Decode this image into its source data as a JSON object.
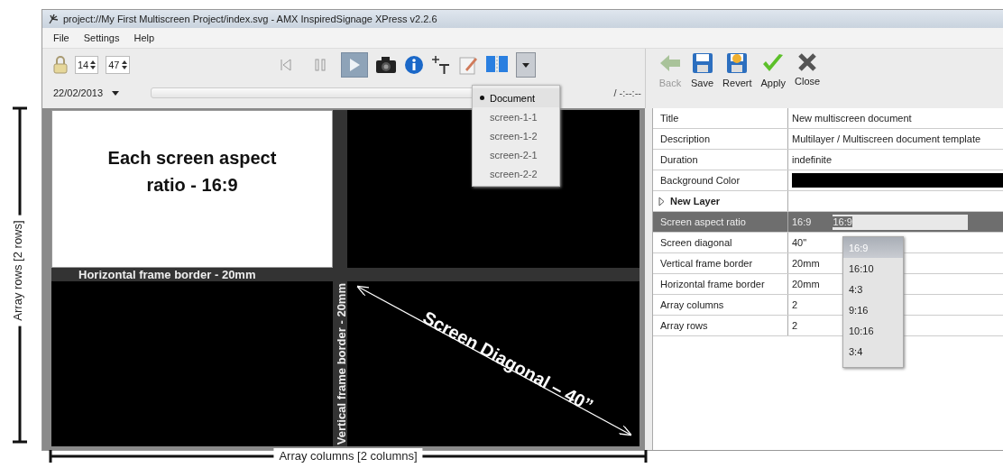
{
  "window": {
    "title": "project://My First Multiscreen Project/index.svg - AMX InspiredSignage XPress v2.2.6"
  },
  "menu": [
    {
      "label": "File"
    },
    {
      "label": "Settings"
    },
    {
      "label": "Help"
    }
  ],
  "toolbar": {
    "hour": "14",
    "minute": "47",
    "date": "22/02/2013",
    "time": "/ -:--:--",
    "transport": [
      {
        "kind": "first",
        "selected": false
      },
      {
        "kind": "pause",
        "selected": false
      },
      {
        "kind": "play",
        "selected": true
      }
    ]
  },
  "screen_menu": {
    "items": [
      {
        "label": "Document",
        "selected": true
      },
      {
        "label": "screen-1-1",
        "selected": false
      },
      {
        "label": "screen-1-2",
        "selected": false
      },
      {
        "label": "screen-2-1",
        "selected": false
      },
      {
        "label": "screen-2-2",
        "selected": false
      }
    ]
  },
  "actions": [
    {
      "kind": "back",
      "label": "Back",
      "disabled": true
    },
    {
      "kind": "save",
      "label": "Save",
      "disabled": false
    },
    {
      "kind": "revert",
      "label": "Revert",
      "disabled": false
    },
    {
      "kind": "apply",
      "label": "Apply",
      "disabled": false
    },
    {
      "kind": "close",
      "label": "Close",
      "disabled": false
    }
  ],
  "properties": [
    {
      "kind": "text",
      "name": "Title",
      "value": "New multiscreen document",
      "selected": false
    },
    {
      "kind": "text",
      "name": "Description",
      "value": "Multilayer / Multiscreen document template",
      "selected": false
    },
    {
      "kind": "text",
      "name": "Duration",
      "value": "indefinite",
      "selected": false
    },
    {
      "kind": "color",
      "name": "Background Color",
      "color": "#000000",
      "selected": false
    },
    {
      "kind": "group",
      "name": "New Layer",
      "expanded": false,
      "selected": false
    },
    {
      "kind": "text",
      "name": "Screen aspect ratio",
      "value": "16:9",
      "selected": true
    },
    {
      "kind": "text",
      "name": "Screen diagonal",
      "value": "40\"",
      "selected": false
    },
    {
      "kind": "text",
      "name": "Vertical frame border",
      "value": "20mm",
      "selected": false
    },
    {
      "kind": "text",
      "name": "Horizontal frame border",
      "value": "20mm",
      "selected": false
    },
    {
      "kind": "text",
      "name": "Array columns",
      "value": "2",
      "selected": false
    },
    {
      "kind": "text",
      "name": "Array rows",
      "value": "2",
      "selected": false
    }
  ],
  "aspect_editor": {
    "value": "16:9",
    "options": [
      {
        "label": "16:9",
        "selected": true
      },
      {
        "label": "16:10",
        "selected": false
      },
      {
        "label": "4:3",
        "selected": false
      },
      {
        "label": "9:16",
        "selected": false
      },
      {
        "label": "10:16",
        "selected": false
      },
      {
        "label": "3:4",
        "selected": false
      }
    ]
  },
  "canvas": {
    "screen_label": "Each screen aspect ratio - 16:9",
    "horizontal_border": "Horizontal frame border - 20mm",
    "vertical_border": "Vertical frame border - 20mm",
    "diagonal": "Screen Diagonal – 40”"
  },
  "annotations": {
    "rows": "Array rows [2 rows]",
    "columns": "Array columns [2 columns]"
  }
}
